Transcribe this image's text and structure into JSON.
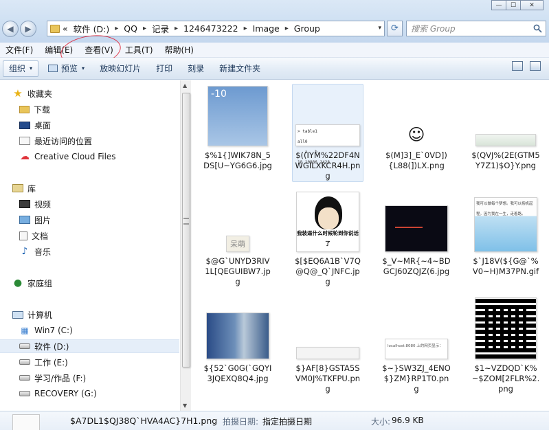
{
  "window": {
    "minimize_glyph": "—",
    "maximize_glyph": "☐",
    "close_glyph": "✕"
  },
  "nav": {
    "back_glyph": "◀",
    "forward_glyph": "▶"
  },
  "address": {
    "lead": "«",
    "crumbs": [
      "软件 (D:)",
      "QQ",
      "记录",
      "1246473222",
      "Image",
      "Group"
    ],
    "sep_glyph": "▸",
    "dropdown_glyph": "▾",
    "refresh_glyph": "⟳"
  },
  "search": {
    "placeholder": "搜索 Group",
    "icon": "search-icon"
  },
  "menu": [
    "文件(F)",
    "编辑(E)",
    "查看(V)",
    "工具(T)",
    "帮助(H)"
  ],
  "toolbar": {
    "organize": "组织",
    "preview": "预览",
    "slideshow": "放映幻灯片",
    "print": "打印",
    "burn": "刻录",
    "new_folder": "新建文件夹",
    "arrow_glyph": "▾"
  },
  "sidebar": {
    "favorites": {
      "label": "收藏夹",
      "items": [
        "下载",
        "桌面",
        "最近访问的位置",
        "Creative Cloud Files"
      ]
    },
    "libraries": {
      "label": "库",
      "items": [
        "视频",
        "图片",
        "文档",
        "音乐"
      ]
    },
    "homegroup": "家庭组",
    "computer": {
      "label": "计算机",
      "items": [
        "Win7 (C:)",
        "软件 (D:)",
        "工作 (E:)",
        "学习/作品 (F:)",
        "RECOVERY (G:)"
      ]
    },
    "selected": "软件 (D:)"
  },
  "files": [
    {
      "name": "$%1{]WIK78N_5DS[U~YG6G6.jpg",
      "thumb": "weather",
      "weather_temp": "-10"
    },
    {
      "name": "$((IYM%22DF4NWGILXKCR4H.png",
      "thumb": "table",
      "selected": true,
      "table_text": "> table1\nall0\n   a   b\n18 10986 1428"
    },
    {
      "name": "$(M]3]_E`0VD]){L88(])LX.png",
      "thumb": "face"
    },
    {
      "name": "$(QVJ%(2E(GTM5Y7Z1)$O}Y.png",
      "thumb": "strip"
    },
    {
      "name": "$@G`UNYD3RIV1L[QEGUIBW7.jpg",
      "thumb": "stamp",
      "stamp_text": "呆萌"
    },
    {
      "name": "$[$EQ6A1B`V7Q@Q@_Q`JNFC.jpg",
      "thumb": "meme",
      "caption": "我装逼什么时候轮到你说话了"
    },
    {
      "name": "$_V~MR{~4~BDGCJ60ZQJZ(6.jpg",
      "thumb": "dark"
    },
    {
      "name": "$`J18V(${G@`%V0~H)M37PN.gif",
      "thumb": "cartoon",
      "cartoon_text": "我可以做每个梦想。我可以扬帆起程。因为我在一生，走着路。"
    },
    {
      "name": "${52`G0G(`GQYI3JQEXQ8Q4.jpg",
      "thumb": "corridor"
    },
    {
      "name": "$}AF[8}GSTA5SVM0J%TKFPU.png",
      "thumb": "bar"
    },
    {
      "name": "$~}SW3ZJ_4ENO$}ZM}RP1T0.png",
      "thumb": "dialog",
      "dialog_text": "localhost:8080 上的网页显示："
    },
    {
      "name": "$1~VZDQD`K%~$ZOM[2FLR%2.png",
      "thumb": "qr"
    }
  ],
  "details": {
    "filename": "$A7DL1$QJ38Q`HVA4AC}7H1.png",
    "date_label": "拍摄日期:",
    "date_value": "指定拍摄日期",
    "size_label": "大小:",
    "size_value": "96.9 KB"
  }
}
